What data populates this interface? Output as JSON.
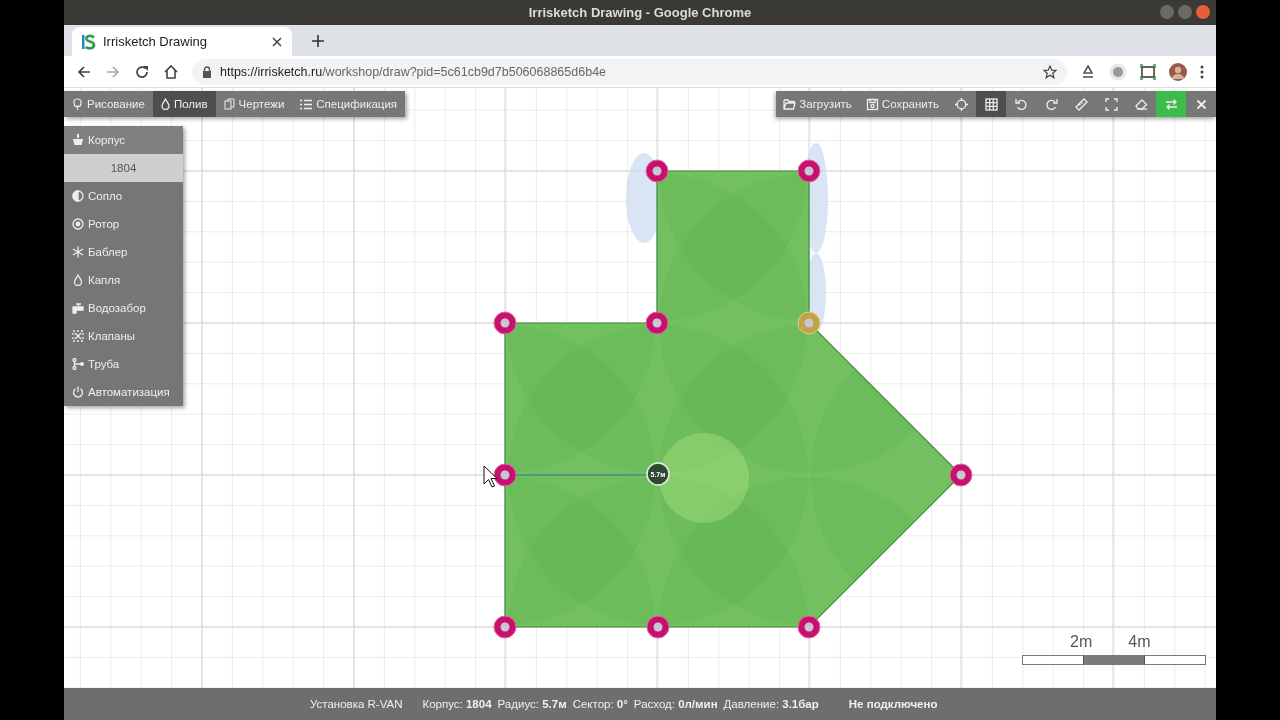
{
  "window": {
    "title": "Irrisketch Drawing - Google Chrome"
  },
  "browser": {
    "tab_title": "Irrisketch Drawing",
    "url_host": "https://irrisketch.ru",
    "url_path": "/workshop/draw?pid=5c61cb9d7b506068865d6b4e"
  },
  "mode_tabs": [
    {
      "label": "Рисование",
      "selected": false
    },
    {
      "label": "Полив",
      "selected": true
    },
    {
      "label": "Чертежи",
      "selected": false
    },
    {
      "label": "Спецификация",
      "selected": false
    }
  ],
  "tools": [
    {
      "kind": "open",
      "label": "Загрузить",
      "selected": false
    },
    {
      "kind": "save",
      "label": "Сохранить",
      "selected": false
    },
    {
      "kind": "target",
      "selected": false
    },
    {
      "kind": "grid",
      "selected": true
    },
    {
      "kind": "undo",
      "selected": false
    },
    {
      "kind": "redo",
      "selected": false
    },
    {
      "kind": "ruler",
      "selected": false
    },
    {
      "kind": "fullscreen",
      "selected": false
    },
    {
      "kind": "eraser",
      "selected": false
    },
    {
      "kind": "swap",
      "selected": false,
      "on": true
    },
    {
      "kind": "close",
      "selected": false
    }
  ],
  "side_panel": [
    {
      "kind": "header",
      "label": "Корпус"
    },
    {
      "kind": "value",
      "label": "1804"
    },
    {
      "kind": "nozzle",
      "label": "Сопло"
    },
    {
      "kind": "rotor",
      "label": "Ротор"
    },
    {
      "kind": "bubbler",
      "label": "Баблер"
    },
    {
      "kind": "drip",
      "label": "Капля"
    },
    {
      "kind": "tap",
      "label": "Водозабор"
    },
    {
      "kind": "valves",
      "label": "Клапаны"
    },
    {
      "kind": "pipe",
      "label": "Труба"
    },
    {
      "kind": "power",
      "label": "Автоматизация"
    }
  ],
  "canvas": {
    "markers": [
      {
        "kind": "vertex"
      },
      {
        "kind": "vertex"
      },
      {
        "kind": "vertex"
      },
      {
        "kind": "vertex"
      },
      {
        "kind": "selected"
      },
      {
        "kind": "vertex"
      },
      {
        "kind": "sprinkler",
        "label": "5.7м"
      },
      {
        "kind": "vertex"
      },
      {
        "kind": "vertex"
      },
      {
        "kind": "vertex"
      },
      {
        "kind": "vertex"
      }
    ],
    "scale": {
      "labels": [
        "2m",
        "4m"
      ]
    }
  },
  "status_bar": {
    "model": "Установка R-VAN",
    "fields": [
      "Корпус: **1804**",
      "Радиус: **5.7м**",
      "Сектор: **0°**",
      "Расход: **0л/мин**",
      "Давление: **3.1бар**"
    ],
    "connection": "Не подключено"
  }
}
